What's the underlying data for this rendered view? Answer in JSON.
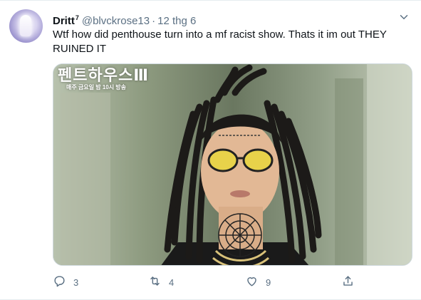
{
  "tweet": {
    "display_name": "Dritt",
    "name_badge": "7",
    "handle": "@blvckrose13",
    "separator": "·",
    "date": "12 thg 6",
    "text": "Wtf how did penthouse turn into a mf racist show. Thats it im out THEY RUINED IT",
    "media": {
      "caption_title": "펜트하우스Ⅲ",
      "caption_subtitle": "매주 금요일 밤 10시 방송"
    },
    "actions": [
      {
        "icon": "reply-icon",
        "count": "3"
      },
      {
        "icon": "retweet-icon",
        "count": "4"
      },
      {
        "icon": "like-icon",
        "count": "9"
      },
      {
        "icon": "share-icon",
        "count": ""
      }
    ]
  },
  "colors": {
    "text_primary": "#0f1419",
    "text_secondary": "#5b7083",
    "border": "#e6ecf0"
  }
}
